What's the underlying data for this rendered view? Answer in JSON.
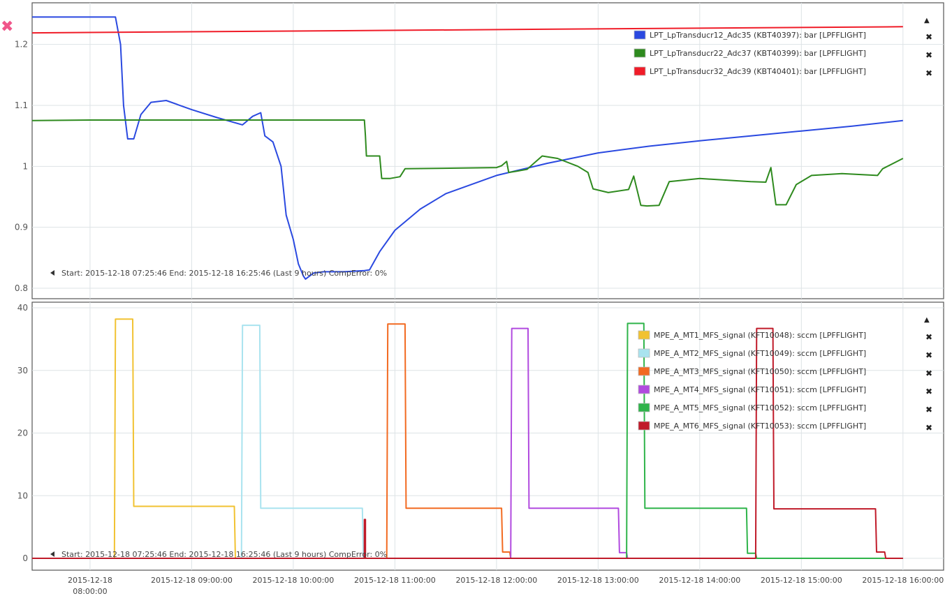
{
  "close_mark": "✖",
  "chart_data": [
    {
      "type": "line",
      "ylim": [
        0.8,
        1.25
      ],
      "yticks": [
        "1.2",
        "1.1",
        "1",
        "0.9",
        "0.8"
      ],
      "grid": true,
      "legend_placement": "top-right",
      "collapse_arrow": "▲",
      "info": "Start: 2015-12-18 07:25:46 End: 2015-12-18 16:25:46 (Last 9 hours) CompError: 0%",
      "series": [
        {
          "name": "LPT_LpTransducr12_Adc35 (KBT40397): bar [LPFFLIGHT]",
          "color": "#2a49e0",
          "x": [
            7.43,
            7.7,
            8.0,
            8.25,
            8.3,
            8.33,
            8.37,
            8.43,
            8.5,
            8.6,
            8.75,
            9.0,
            9.25,
            9.5,
            9.6,
            9.68,
            9.72,
            9.8,
            9.88,
            9.93,
            10.0,
            10.05,
            10.1,
            10.12,
            10.2,
            10.3,
            10.5,
            10.7,
            10.75,
            10.85,
            11.0,
            11.25,
            11.5,
            12.0,
            12.5,
            13.0,
            13.5,
            14.0,
            14.5,
            15.0,
            15.5,
            16.0,
            16.0
          ],
          "y": [
            1.245,
            1.245,
            1.245,
            1.245,
            1.2,
            1.1,
            1.045,
            1.045,
            1.085,
            1.105,
            1.108,
            1.093,
            1.08,
            1.068,
            1.082,
            1.088,
            1.05,
            1.04,
            1.0,
            0.92,
            0.88,
            0.84,
            0.82,
            0.815,
            0.825,
            0.827,
            0.827,
            0.829,
            0.83,
            0.86,
            0.895,
            0.93,
            0.955,
            0.985,
            1.005,
            1.022,
            1.033,
            1.042,
            1.05,
            1.058,
            1.066,
            1.075,
            1.075
          ]
        },
        {
          "name": "LPT_LpTransducr22_Adc37 (KBT40399): bar [LPFFLIGHT]",
          "color": "#2e8a1e",
          "x": [
            7.43,
            8.0,
            9.0,
            10.0,
            10.7,
            10.71,
            10.72,
            10.85,
            10.87,
            10.95,
            11.05,
            11.1,
            12.0,
            12.05,
            12.1,
            12.12,
            12.2,
            12.3,
            12.45,
            12.6,
            12.8,
            12.9,
            12.95,
            13.1,
            13.3,
            13.35,
            13.42,
            13.48,
            13.6,
            13.7,
            14.0,
            14.5,
            14.65,
            14.7,
            14.75,
            14.85,
            14.95,
            15.1,
            15.4,
            15.75,
            15.8,
            16.0
          ],
          "y": [
            1.075,
            1.076,
            1.076,
            1.076,
            1.076,
            1.05,
            1.017,
            1.017,
            0.98,
            0.98,
            0.983,
            0.996,
            0.998,
            1.001,
            1.008,
            0.99,
            0.992,
            0.995,
            1.017,
            1.013,
            1.0,
            0.99,
            0.963,
            0.957,
            0.962,
            0.984,
            0.936,
            0.935,
            0.936,
            0.975,
            0.98,
            0.975,
            0.974,
            0.998,
            0.937,
            0.937,
            0.97,
            0.985,
            0.988,
            0.985,
            0.996,
            1.013
          ]
        },
        {
          "name": "LPT_LpTransducr32_Adc39 (KBT40401): bar [LPFFLIGHT]",
          "color": "#f01c28",
          "x": [
            7.43,
            16.0
          ],
          "y": [
            1.219,
            1.229
          ]
        }
      ]
    },
    {
      "type": "line",
      "ylim": [
        0,
        40
      ],
      "yticks": [
        "40",
        "30",
        "20",
        "10",
        "0"
      ],
      "xticks": [
        "2015-12-18 08:00:00",
        "2015-12-18 09:00:00",
        "2015-12-18 10:00:00",
        "2015-12-18 11:00:00",
        "2015-12-18 12:00:00",
        "2015-12-18 13:00:00",
        "2015-12-18 14:00:00",
        "2015-12-18 15:00:00",
        "2015-12-18 16:00:00"
      ],
      "grid": true,
      "legend_placement": "top-right",
      "collapse_arrow": "▲",
      "info": "Start: 2015-12-18 07:25:46 End: 2015-12-18 16:25:46 (Last 9 hours) CompError: 0%",
      "series": [
        {
          "name": "MPE_A_MT1_MFS_signal (KFT10048): sccm [LPFFLIGHT]",
          "color": "#f1c232",
          "x": [
            7.43,
            8.24,
            8.25,
            8.42,
            8.43,
            9.42,
            9.43,
            16.0
          ],
          "y": [
            0,
            0,
            38.2,
            38.2,
            8.3,
            8.3,
            0,
            0
          ]
        },
        {
          "name": "MPE_A_MT2_MFS_signal (KFT10049): sccm [LPFFLIGHT]",
          "color": "#a9e3ef",
          "x": [
            7.43,
            9.49,
            9.5,
            9.67,
            9.68,
            10.68,
            10.69,
            16.0
          ],
          "y": [
            0,
            0,
            37.2,
            37.2,
            8.0,
            8.0,
            0,
            0
          ]
        },
        {
          "name": "MPE_A_MT3_MFS_signal (KFT10050): sccm [LPFFLIGHT]",
          "color": "#f26a21",
          "x": [
            7.43,
            10.92,
            10.93,
            11.1,
            11.11,
            12.05,
            12.06,
            12.13,
            12.14,
            16.0
          ],
          "y": [
            0,
            0,
            37.4,
            37.4,
            8.0,
            8.0,
            1.0,
            1.0,
            0,
            0
          ]
        },
        {
          "name": "MPE_A_MT4_MFS_signal (KFT10051): sccm [LPFFLIGHT]",
          "color": "#b14adf",
          "x": [
            7.43,
            12.14,
            12.15,
            12.31,
            12.32,
            13.2,
            13.21,
            13.28,
            13.29,
            16.0
          ],
          "y": [
            0,
            0,
            36.7,
            36.7,
            8.0,
            8.0,
            0.9,
            0.9,
            0,
            0
          ]
        },
        {
          "name": "MPE_A_MT5_MFS_signal (KFT10052): sccm [LPFFLIGHT]",
          "color": "#2fb44a",
          "x": [
            7.43,
            13.28,
            13.29,
            13.45,
            13.46,
            14.46,
            14.47,
            14.55,
            14.56,
            16.0
          ],
          "y": [
            0,
            0,
            37.5,
            37.5,
            8.0,
            8.0,
            0.8,
            0.8,
            0,
            0
          ]
        },
        {
          "name": "MPE_A_MT6_MFS_signal (KFT10053): sccm [LPFFLIGHT]",
          "color": "#c01b2a",
          "x": [
            7.43,
            10.7,
            10.7,
            10.71,
            10.71,
            14.55,
            14.56,
            14.72,
            14.73,
            15.73,
            15.74,
            15.82,
            15.83,
            16.0
          ],
          "y": [
            0,
            0,
            6.2,
            6.2,
            0,
            0,
            36.7,
            36.7,
            7.9,
            7.9,
            1.0,
            1.0,
            0,
            0
          ]
        }
      ]
    }
  ]
}
